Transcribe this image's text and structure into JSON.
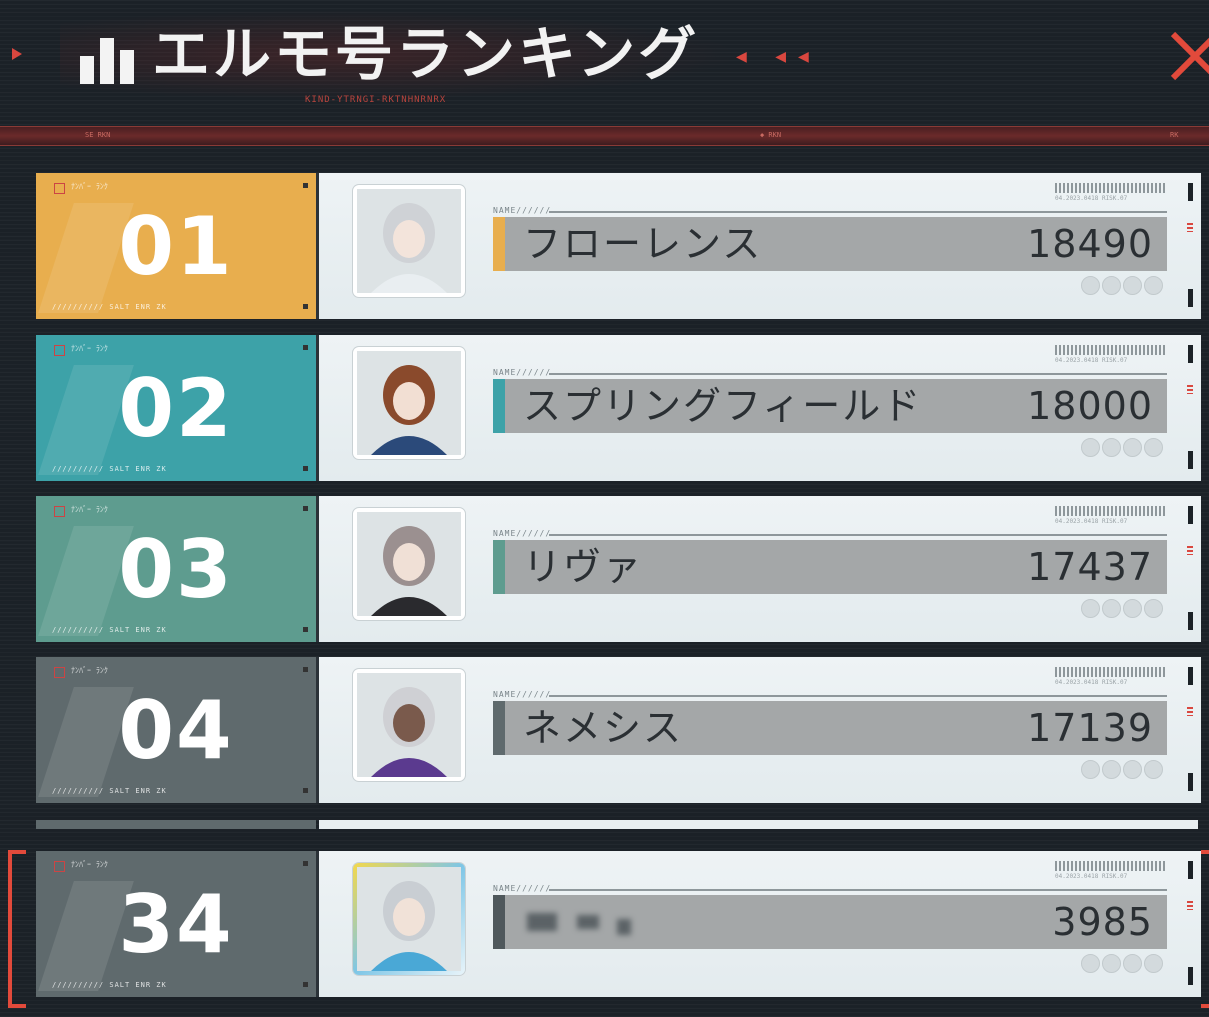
{
  "header": {
    "title": "エルモ号ランキング",
    "subtitle": "KIND-YTRNGI-RKTNHNRNRX",
    "deco": "◀ ◀◀",
    "close_icon": "close-x-icon",
    "bars_icon": "bar-chart-icon"
  },
  "card_micro": {
    "top": "ﾅﾝﾊﾞｰ  ﾗﾝｸ",
    "bottom": "//////////   SALT  ENR  ZK",
    "name_label": "NAME//////",
    "barcode_text": "04.2023.0418 RISK.07"
  },
  "colors": {
    "gold": "#e8ae4e",
    "teal": "#3da2a8",
    "sage": "#5e9c8f",
    "slate": "#5f6a6d",
    "accent_red": "#e24a3b"
  },
  "rankings": [
    {
      "rank": "01",
      "name": "フローレンス",
      "score": "18490",
      "color": "#e8ae4e"
    },
    {
      "rank": "02",
      "name": "スプリングフィールド",
      "score": "18000",
      "color": "#3da2a8"
    },
    {
      "rank": "03",
      "name": "リヴァ",
      "score": "17437",
      "color": "#5e9c8f"
    },
    {
      "rank": "04",
      "name": "ネメシス",
      "score": "17139",
      "color": "#5f6a6d"
    }
  ],
  "self": {
    "rank": "34",
    "name": "",
    "score": "3985",
    "color": "#5f6a6d"
  }
}
